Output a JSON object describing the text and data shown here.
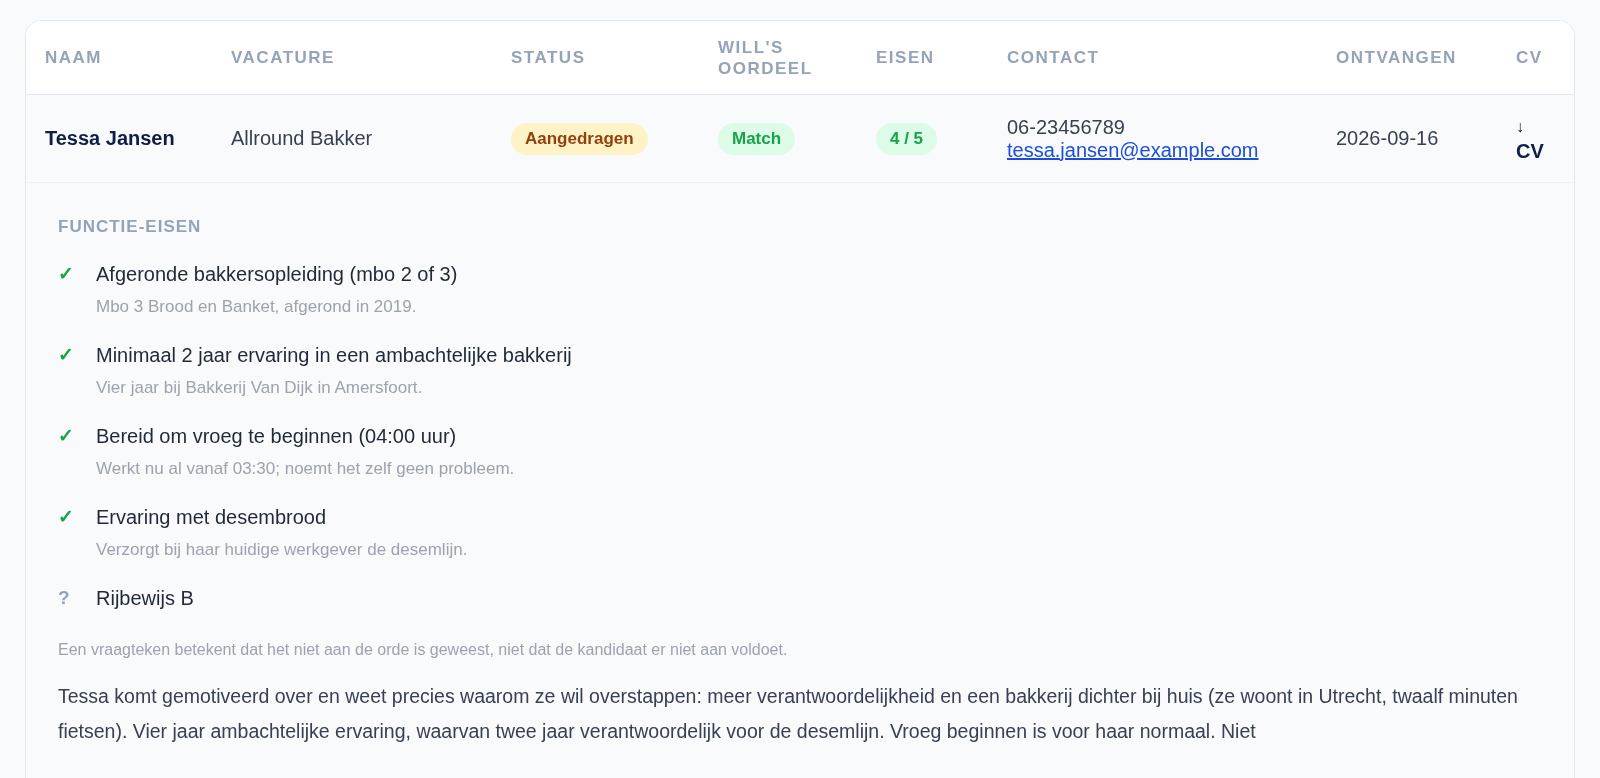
{
  "table": {
    "columns": [
      "NAAM",
      "VACATURE",
      "STATUS",
      "WILL'S OORDEEL",
      "EISEN",
      "CONTACT",
      "ONTVANGEN",
      "CV"
    ],
    "row": {
      "name": "Tessa Jansen",
      "vacancy": "Allround Bakker",
      "status": "Aangedragen",
      "verdict": "Match",
      "requirements_score": "4 / 5",
      "phone": "06-23456789",
      "email": "tessa.jansen@example.com",
      "received": "2026-09-16",
      "cv_icon": "↓",
      "cv_label": "CV"
    }
  },
  "details": {
    "heading": "FUNCTIE-EISEN",
    "requirements": [
      {
        "mark": "✓",
        "met": true,
        "title": "Afgeronde bakkersopleiding (mbo 2 of 3)",
        "note": "Mbo 3 Brood en Banket, afgerond in 2019."
      },
      {
        "mark": "✓",
        "met": true,
        "title": "Minimaal 2 jaar ervaring in een ambachtelijke bakkerij",
        "note": "Vier jaar bij Bakkerij Van Dijk in Amersfoort."
      },
      {
        "mark": "✓",
        "met": true,
        "title": "Bereid om vroeg te beginnen (04:00 uur)",
        "note": "Werkt nu al vanaf 03:30; noemt het zelf geen probleem."
      },
      {
        "mark": "✓",
        "met": true,
        "title": "Ervaring met desembrood",
        "note": "Verzorgt bij haar huidige werkgever de desemlijn."
      },
      {
        "mark": "?",
        "met": false,
        "title": "Rijbewijs B"
      }
    ],
    "footnote": "Een vraagteken betekent dat het niet aan de orde is geweest, niet dat de kandidaat er niet aan voldoet.",
    "summary": "Tessa komt gemotiveerd over en weet precies waarom ze wil overstappen: meer verantwoordelijkheid en een bakkerij dichter bij huis (ze woont in Utrecht, twaalf minuten fietsen). Vier jaar ambachtelijke ervaring, waarvan twee jaar verantwoordelijk voor de desemlijn. Vroeg beginnen is voor haar normaal. Niet"
  }
}
